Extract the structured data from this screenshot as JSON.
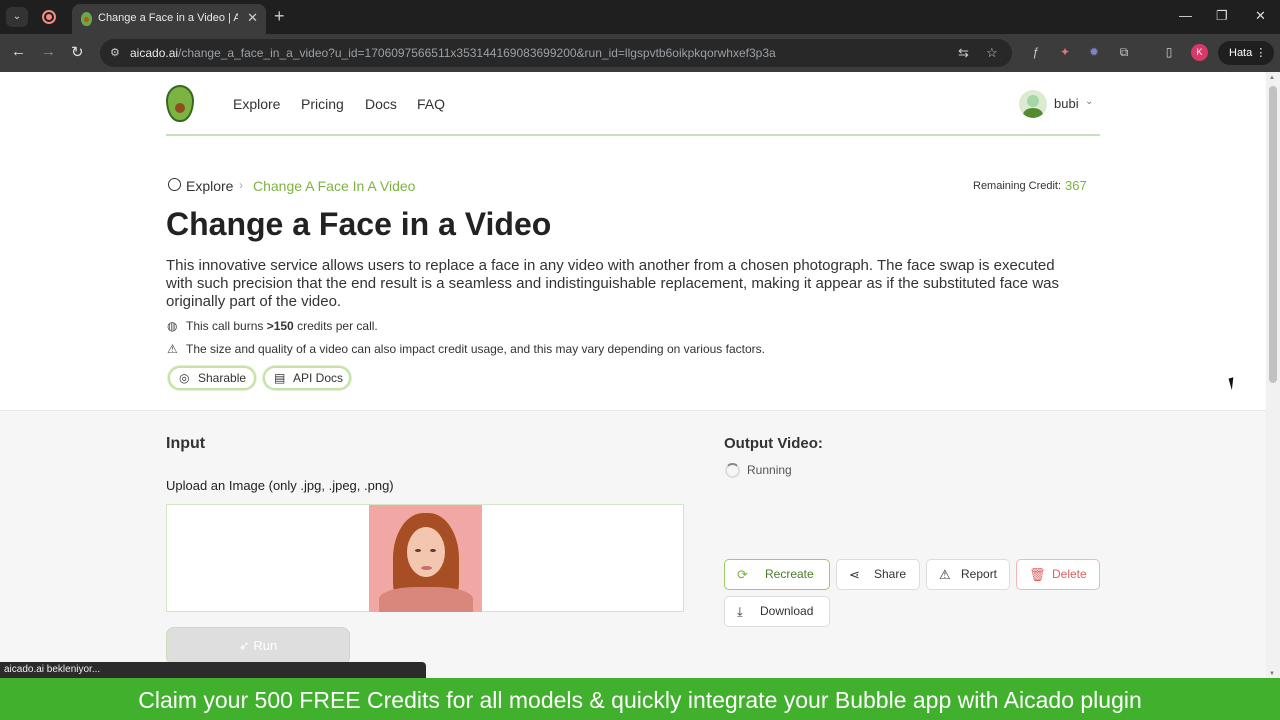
{
  "browser": {
    "tab_title": "Change a Face in a Video | Aicado",
    "url_host": "aicado.ai",
    "url_path": "/change_a_face_in_a_video?u_id=1706097566511x353144169083699200&run_id=llgspvtb6oikpkqorwhxef3p3a",
    "profile_initial": "K",
    "profile_label": "Hata",
    "status_text": "aicado.ai bekleniyor..."
  },
  "header": {
    "nav": [
      "Explore",
      "Pricing",
      "Docs",
      "FAQ"
    ],
    "username": "bubi"
  },
  "breadcrumb": {
    "root": "Explore",
    "current": "Change A Face In A Video"
  },
  "credit": {
    "label": "Remaining Credit:",
    "value": "367"
  },
  "service": {
    "title": "Change a Face in a Video",
    "description": "This innovative service allows users to replace a face in any video with another from a chosen photograph. The face swap is executed with such precision that the end result is a seamless and indistinguishable replacement, making it appear as if the substituted face was originally part of the video.",
    "burn_prefix": "This call burns ",
    "burn_amount": ">150",
    "burn_suffix": " credits per call.",
    "warning": "The size and quality of a video can also impact credit usage, and this may vary depending on various factors.",
    "chips": [
      "Sharable",
      "API Docs"
    ]
  },
  "input": {
    "heading": "Input",
    "upload_label": "Upload an Image (only .jpg, .jpeg, .png)",
    "run_label": "Run"
  },
  "output": {
    "heading": "Output Video:",
    "status": "Running",
    "buttons": {
      "recreate": "Recreate",
      "share": "Share",
      "report": "Report",
      "delete": "Delete",
      "download": "Download"
    }
  },
  "banner": "Claim your 500 FREE Credits for all models & quickly integrate your Bubble app with Aicado plugin",
  "colors": {
    "brand_green": "#7cb342",
    "banner_green": "#41b02d",
    "delete_red": "#e06060"
  }
}
